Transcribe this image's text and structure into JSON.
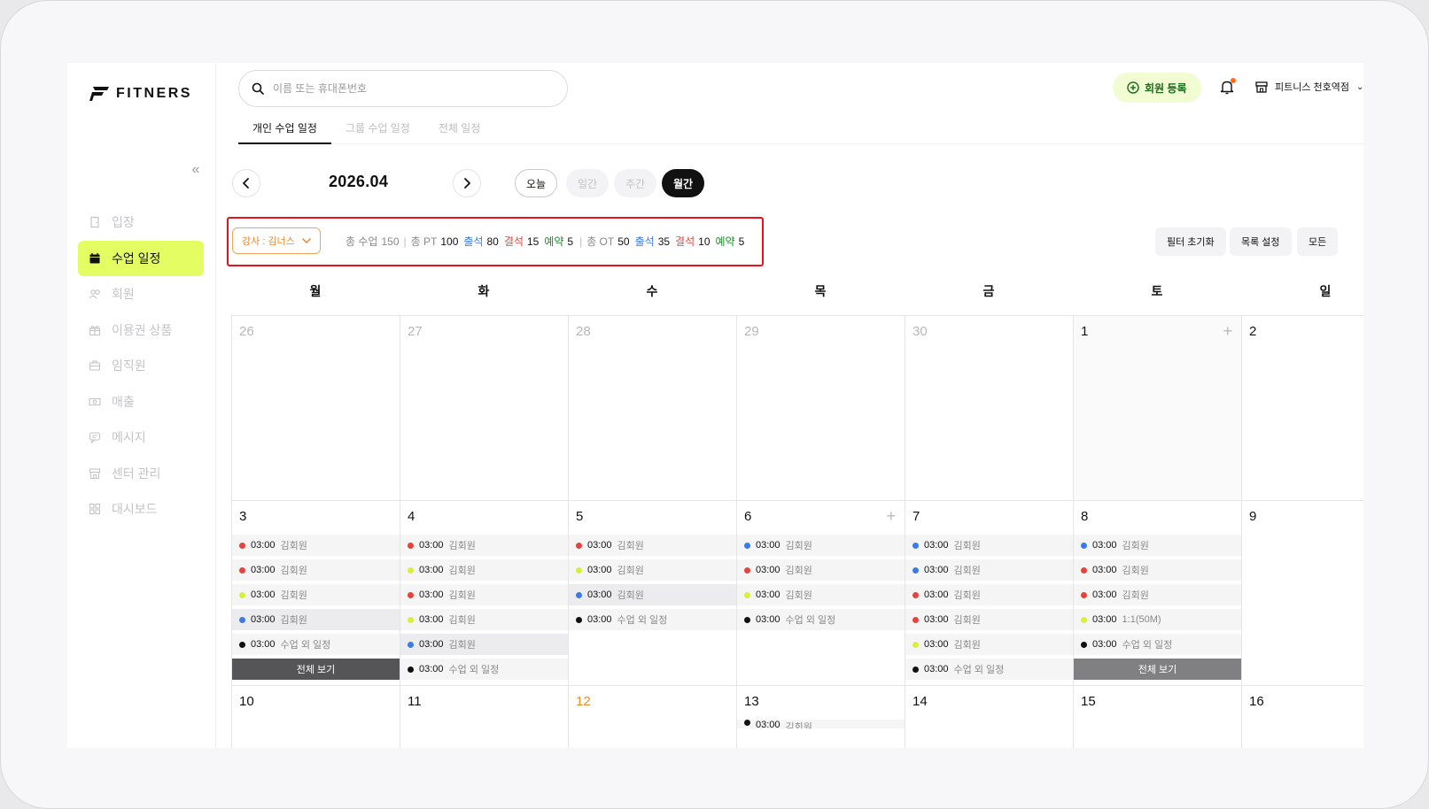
{
  "brand": {
    "name": "FITNERS"
  },
  "sidebar": {
    "items": [
      {
        "label": "입장",
        "icon": "door-icon",
        "active": false
      },
      {
        "label": "수업 일정",
        "icon": "calendar-icon",
        "active": true
      },
      {
        "label": "회원",
        "icon": "users-icon",
        "active": false
      },
      {
        "label": "이용권 상품",
        "icon": "gift-icon",
        "active": false
      },
      {
        "label": "임직원",
        "icon": "briefcase-icon",
        "active": false
      },
      {
        "label": "매출",
        "icon": "cash-icon",
        "active": false
      },
      {
        "label": "메시지",
        "icon": "message-icon",
        "active": false
      },
      {
        "label": "센터 관리",
        "icon": "store-icon",
        "active": false
      },
      {
        "label": "대시보드",
        "icon": "dashboard-icon",
        "active": false
      }
    ]
  },
  "header": {
    "search_placeholder": "이름 또는 휴대폰번호",
    "register_label": "회원 등록",
    "store_name": "피트니스 천호역점"
  },
  "tabs": [
    {
      "label": "개인 수업 일정",
      "active": true
    },
    {
      "label": "그룹 수업 일정",
      "active": false
    },
    {
      "label": "전체 일정",
      "active": false
    }
  ],
  "date_nav": {
    "title": "2026.04",
    "today_label": "오늘",
    "views": [
      {
        "label": "일간",
        "active": false
      },
      {
        "label": "주간",
        "active": false
      },
      {
        "label": "월간",
        "active": true
      }
    ]
  },
  "filters": {
    "teacher_label": "강사 : 김너스",
    "stats": {
      "total_label": "총 수업",
      "total_value": "150",
      "pt_label": "총 PT",
      "pt_value": "100",
      "pt_attend_label": "출석",
      "pt_attend_value": "80",
      "pt_absent_label": "결석",
      "pt_absent_value": "15",
      "pt_reserve_label": "예약",
      "pt_reserve_value": "5",
      "ot_label": "총 OT",
      "ot_value": "50",
      "ot_attend_label": "출석",
      "ot_attend_value": "35",
      "ot_absent_label": "결석",
      "ot_absent_value": "10",
      "ot_reserve_label": "예약",
      "ot_reserve_value": "5"
    },
    "reset_label": "필터 초기화",
    "list_setting_label": "목록 설정",
    "all_label": "모든"
  },
  "colors": {
    "accent": "#e4fd63",
    "red": "#e8433b",
    "blue": "#3a7be8",
    "yellow": "#d9ef3a",
    "black": "#111111",
    "orange": "#ee8e1e"
  },
  "calendar": {
    "weekdays": [
      "월",
      "화",
      "수",
      "목",
      "금",
      "토",
      "일"
    ],
    "view_all_label": "전체 보기",
    "weeks": [
      {
        "days": [
          {
            "num": "26",
            "dim": true,
            "events": []
          },
          {
            "num": "27",
            "dim": true,
            "events": []
          },
          {
            "num": "28",
            "dim": true,
            "events": []
          },
          {
            "num": "29",
            "dim": true,
            "events": []
          },
          {
            "num": "30",
            "dim": true,
            "events": []
          },
          {
            "num": "1",
            "plus": true,
            "events": []
          },
          {
            "num": "2",
            "events": []
          }
        ]
      },
      {
        "days": [
          {
            "num": "3",
            "view_all": true,
            "events": [
              {
                "c": "red",
                "time": "03:00",
                "name": "김회원"
              },
              {
                "c": "red",
                "time": "03:00",
                "name": "김회원"
              },
              {
                "c": "yellow",
                "time": "03:00",
                "name": "김회원"
              },
              {
                "c": "blue",
                "time": "03:00",
                "name": "김회원",
                "hl": true
              },
              {
                "c": "black",
                "time": "03:00",
                "name": "수업 외 일정"
              }
            ]
          },
          {
            "num": "4",
            "events": [
              {
                "c": "red",
                "time": "03:00",
                "name": "김회원"
              },
              {
                "c": "yellow",
                "time": "03:00",
                "name": "김회원"
              },
              {
                "c": "red",
                "time": "03:00",
                "name": "김회원"
              },
              {
                "c": "yellow",
                "time": "03:00",
                "name": "김회원"
              },
              {
                "c": "blue",
                "time": "03:00",
                "name": "김회원",
                "hl": true
              },
              {
                "c": "black",
                "time": "03:00",
                "name": "수업 외 일정"
              }
            ]
          },
          {
            "num": "5",
            "events": [
              {
                "c": "red",
                "time": "03:00",
                "name": "김회원"
              },
              {
                "c": "yellow",
                "time": "03:00",
                "name": "김회원"
              },
              {
                "c": "blue",
                "time": "03:00",
                "name": "김회원",
                "hl": true
              },
              {
                "c": "black",
                "time": "03:00",
                "name": "수업 외 일정"
              }
            ]
          },
          {
            "num": "6",
            "plus": true,
            "events": [
              {
                "c": "blue",
                "time": "03:00",
                "name": "김회원"
              },
              {
                "c": "red",
                "time": "03:00",
                "name": "김회원"
              },
              {
                "c": "yellow",
                "time": "03:00",
                "name": "김회원"
              },
              {
                "c": "black",
                "time": "03:00",
                "name": "수업 외 일정"
              }
            ]
          },
          {
            "num": "7",
            "events": [
              {
                "c": "blue",
                "time": "03:00",
                "name": "김회원"
              },
              {
                "c": "blue",
                "time": "03:00",
                "name": "김회원"
              },
              {
                "c": "red",
                "time": "03:00",
                "name": "김회원"
              },
              {
                "c": "red",
                "time": "03:00",
                "name": "김회원"
              },
              {
                "c": "yellow",
                "time": "03:00",
                "name": "김회원"
              },
              {
                "c": "black",
                "time": "03:00",
                "name": "수업 외 일정"
              }
            ]
          },
          {
            "num": "8",
            "view_all": true,
            "view_all_light": true,
            "events": [
              {
                "c": "blue",
                "time": "03:00",
                "name": "김회원"
              },
              {
                "c": "red",
                "time": "03:00",
                "name": "김회원"
              },
              {
                "c": "red",
                "time": "03:00",
                "name": "김회원"
              },
              {
                "c": "yellow",
                "time": "03:00",
                "name": "1:1(50M)"
              },
              {
                "c": "black",
                "time": "03:00",
                "name": "수업 외 일정"
              }
            ]
          },
          {
            "num": "9",
            "events": []
          }
        ]
      },
      {
        "days": [
          {
            "num": "10",
            "events": []
          },
          {
            "num": "11",
            "events": []
          },
          {
            "num": "12",
            "orange": true,
            "events": []
          },
          {
            "num": "13",
            "events": [
              {
                "c": "black",
                "time": "03:00",
                "name": "김회원"
              }
            ]
          },
          {
            "num": "14",
            "events": []
          },
          {
            "num": "15",
            "events": []
          },
          {
            "num": "16",
            "events": []
          }
        ]
      }
    ]
  }
}
